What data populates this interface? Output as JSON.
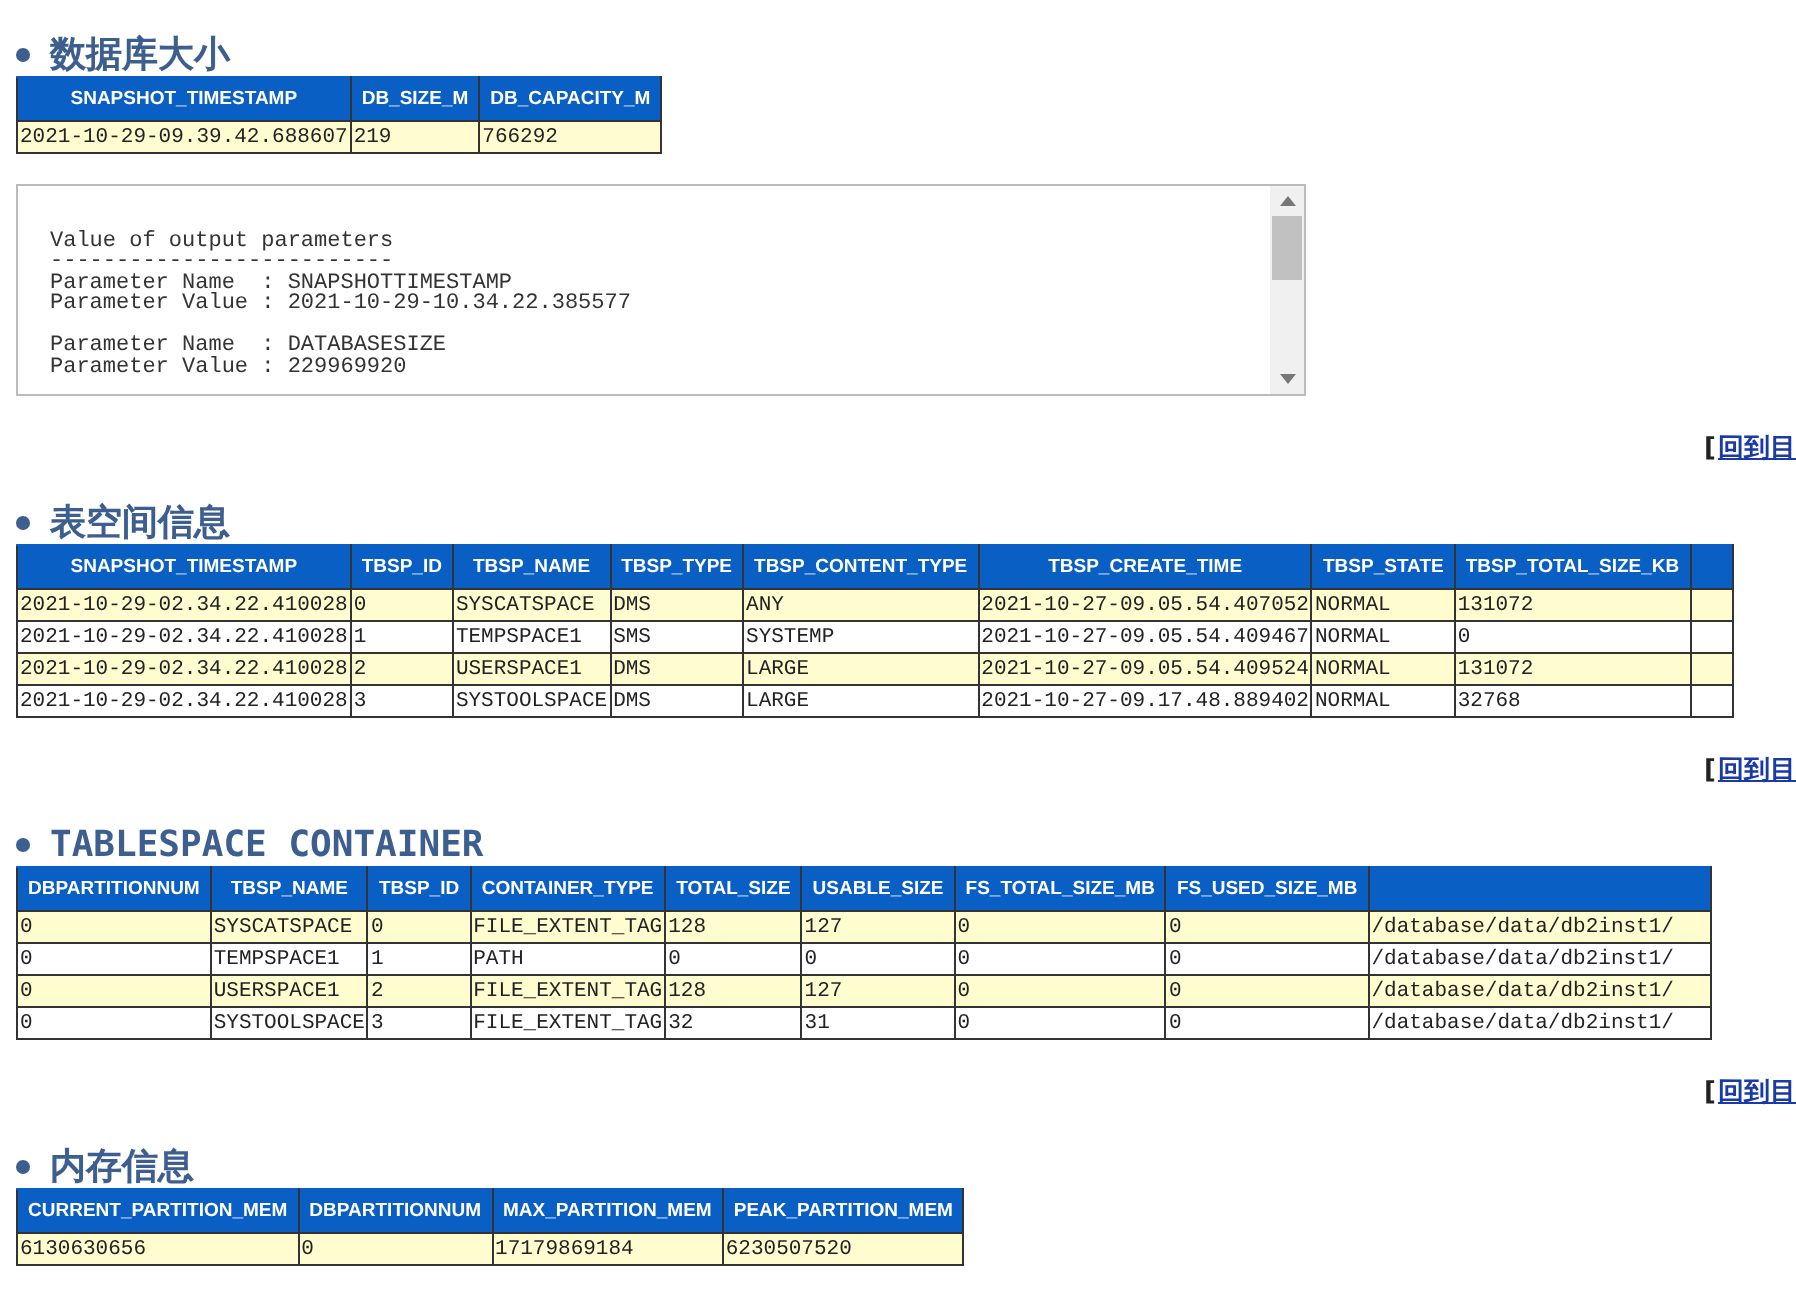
{
  "sections": [
    {
      "kind": "heading",
      "text": "数据库大小"
    },
    {
      "kind": "table",
      "columns": [
        "SNAPSHOT_TIMESTAMP",
        "DB_SIZE_M",
        "DB_CAPACITY_M"
      ],
      "rows": [
        [
          "2021-10-29-09.39.42.688607",
          "219",
          "766292"
        ]
      ]
    },
    {
      "kind": "output",
      "groups": [
        [
          "Value of output parameters",
          "--------------------------",
          "Parameter Name  : SNAPSHOTTIMESTAMP",
          "Parameter Value : 2021-10-29-10.34.22.385577"
        ],
        [
          "Parameter Name  : DATABASESIZE",
          "Parameter Value : 229969920"
        ]
      ]
    },
    {
      "kind": "back_link",
      "bracket": "[",
      "link": "回到目"
    },
    {
      "kind": "heading",
      "text": "表空间信息"
    },
    {
      "kind": "table",
      "truncated": true,
      "columns": [
        "SNAPSHOT_TIMESTAMP",
        "TBSP_ID",
        "TBSP_NAME",
        "TBSP_TYPE",
        "TBSP_CONTENT_TYPE",
        "TBSP_CREATE_TIME",
        "TBSP_STATE",
        "TBSP_TOTAL_SIZE_KB"
      ],
      "rows": [
        [
          "2021-10-29-02.34.22.410028",
          "0",
          "SYSCATSPACE",
          "DMS",
          "ANY",
          "2021-10-27-09.05.54.407052",
          "NORMAL",
          "131072"
        ],
        [
          "2021-10-29-02.34.22.410028",
          "1",
          "TEMPSPACE1",
          "SMS",
          "SYSTEMP",
          "2021-10-27-09.05.54.409467",
          "NORMAL",
          "0"
        ],
        [
          "2021-10-29-02.34.22.410028",
          "2",
          "USERSPACE1",
          "DMS",
          "LARGE",
          "2021-10-27-09.05.54.409524",
          "NORMAL",
          "131072"
        ],
        [
          "2021-10-29-02.34.22.410028",
          "3",
          "SYSTOOLSPACE",
          "DMS",
          "LARGE",
          "2021-10-27-09.17.48.889402",
          "NORMAL",
          "32768"
        ]
      ]
    },
    {
      "kind": "back_link",
      "bracket": "[",
      "link": "回到目"
    },
    {
      "kind": "heading",
      "text": "TABLESPACE CONTAINER"
    },
    {
      "kind": "table",
      "columns": [
        "DBPARTITIONNUM",
        "TBSP_NAME",
        "TBSP_ID",
        "CONTAINER_TYPE",
        "TOTAL_SIZE",
        "USABLE_SIZE",
        "FS_TOTAL_SIZE_MB",
        "FS_USED_SIZE_MB"
      ],
      "rows": [
        [
          "0",
          "SYSCATSPACE",
          "0",
          "FILE_EXTENT_TAG",
          "128",
          "127",
          "0",
          "0",
          "/database/data/db2inst1/"
        ],
        [
          "0",
          "TEMPSPACE1",
          "1",
          "PATH",
          "0",
          "0",
          "0",
          "0",
          "/database/data/db2inst1/"
        ],
        [
          "0",
          "USERSPACE1",
          "2",
          "FILE_EXTENT_TAG",
          "128",
          "127",
          "0",
          "0",
          "/database/data/db2inst1/"
        ],
        [
          "0",
          "SYSTOOLSPACE",
          "3",
          "FILE_EXTENT_TAG",
          "32",
          "31",
          "0",
          "0",
          "/database/data/db2inst1/"
        ]
      ]
    },
    {
      "kind": "back_link",
      "bracket": "[",
      "link": "回到目"
    },
    {
      "kind": "heading",
      "text": "内存信息"
    },
    {
      "kind": "table",
      "columns": [
        "CURRENT_PARTITION_MEM",
        "DBPARTITIONNUM",
        "MAX_PARTITION_MEM",
        "PEAK_PARTITION_MEM"
      ],
      "rows": [
        [
          "6130630656",
          "0",
          "17179869184",
          "6230507520"
        ]
      ]
    }
  ]
}
